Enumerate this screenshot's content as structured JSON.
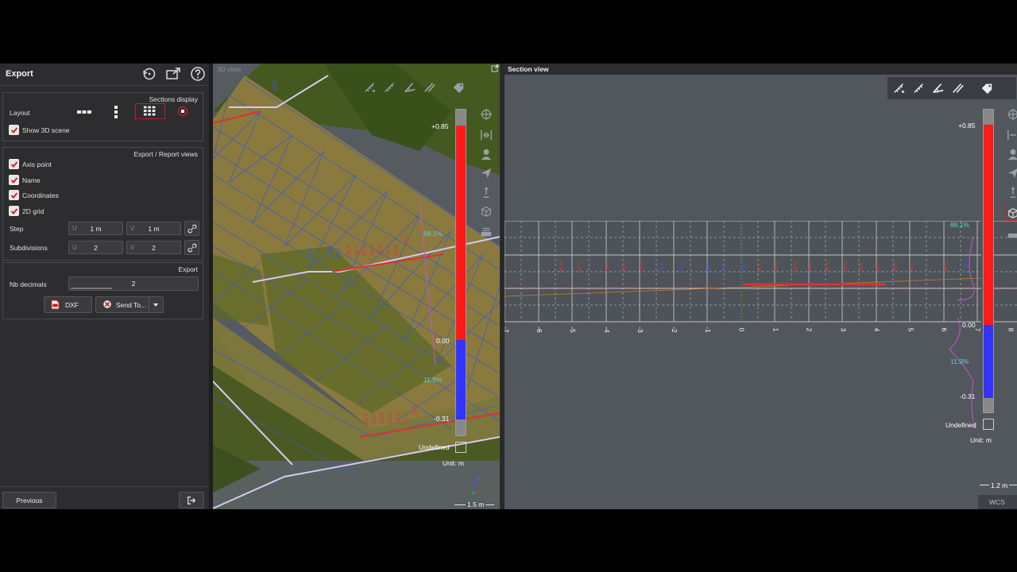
{
  "panel": {
    "title": "Export",
    "sections_display": {
      "title": "Sections display",
      "layout_label": "Layout",
      "show_3d_label": "Show 3D scene"
    },
    "report_views": {
      "title": "Export / Report views",
      "items": [
        {
          "label": "Axis point",
          "checked": true
        },
        {
          "label": "Name",
          "checked": true
        },
        {
          "label": "Coordinates",
          "checked": true
        },
        {
          "label": "2D grid",
          "checked": true
        }
      ],
      "step": {
        "label": "Step",
        "u_prefix": "U",
        "u_value": "1 m",
        "v_prefix": "V",
        "v_value": "1 m"
      },
      "subdivisions": {
        "label": "Subdivisions",
        "u_prefix": "U",
        "u_value": "2",
        "v_prefix": "V",
        "v_value": "2"
      }
    },
    "export": {
      "title": "Export",
      "nb_decimals_label": "Nb decimals",
      "nb_decimals_value": "2",
      "dxf_label": "DXF",
      "send_to_label": "Send To..."
    },
    "previous_label": "Previous"
  },
  "view3d": {
    "title": "3D view",
    "scale_max": "+0.85",
    "scale_zero": "0.00",
    "scale_min": "-0.31",
    "pct_top": "88.1%",
    "pct_bottom": "11.9%",
    "undefined_label": "Undefined",
    "unit_label": "Unit: m",
    "scale_bar": "1.5 m"
  },
  "section": {
    "title": "Section view",
    "scale_max": "+0.85",
    "scale_zero": "0.00",
    "scale_min": "-0.31",
    "pct_top": "88.1%",
    "pct_bottom": "11.9%",
    "undefined_label": "Undefined",
    "unit_label": "Unit: m",
    "scale_bar": "1.2 m",
    "wcs_label": "WCS",
    "axis_ticks": [
      "-7",
      "-6",
      "-5",
      "-4",
      "-3",
      "-2",
      "-1",
      "0",
      "1",
      "2",
      "3",
      "4",
      "5",
      "6",
      "7",
      "8"
    ]
  },
  "colors": {
    "panel_bg": "#2d2d30",
    "viewport_bg": "#555a60",
    "scale_red": "#ff1a1a",
    "scale_blue": "#3333ff",
    "accent_cyan": "#5fd0d0",
    "layout_selected": "#c02020"
  }
}
